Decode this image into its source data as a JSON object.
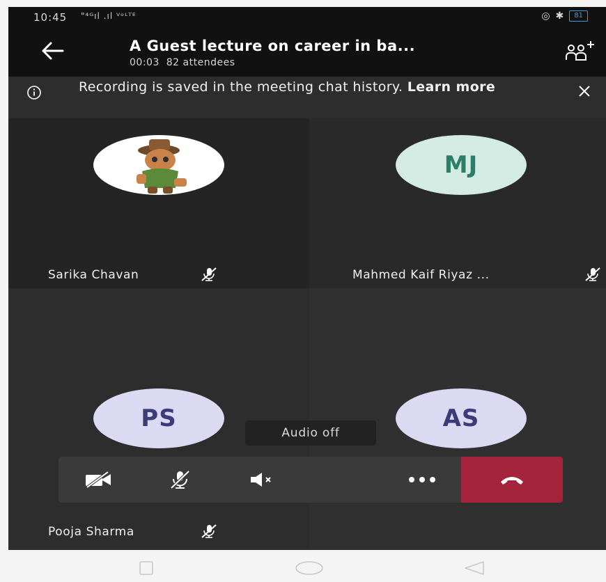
{
  "status_bar": {
    "time": "10:45",
    "signal": "\"⁴ᴳıl .ıl ⱽᵒᴸᵀᴱ",
    "battery": "81"
  },
  "meeting": {
    "title": "A Guest lecture on career in ba...",
    "duration": "00:03",
    "attendees": "82 attendees"
  },
  "banner": {
    "message": "Recording is saved in the meeting chat history.",
    "link": "Learn more"
  },
  "participants": [
    {
      "name": "Sarika Chavan",
      "initials": "",
      "has_photo": true
    },
    {
      "name": "Mahmed Kaif Riyaz ...",
      "initials": "MJ",
      "avatar_color": "#d3ebe3"
    },
    {
      "name": "Pooja Sharma",
      "initials": "PS",
      "avatar_color": "#dcd9f2"
    },
    {
      "name": "",
      "initials": "AS",
      "avatar_color": "#dcd9f2"
    }
  ],
  "toast": "Audio off",
  "controls": [
    "camera-off-icon",
    "mic-off-icon",
    "speaker-off-icon",
    "more-icon",
    "hang-up-icon"
  ],
  "colors": {
    "hangup": "#a4243b",
    "background": "#292929"
  }
}
